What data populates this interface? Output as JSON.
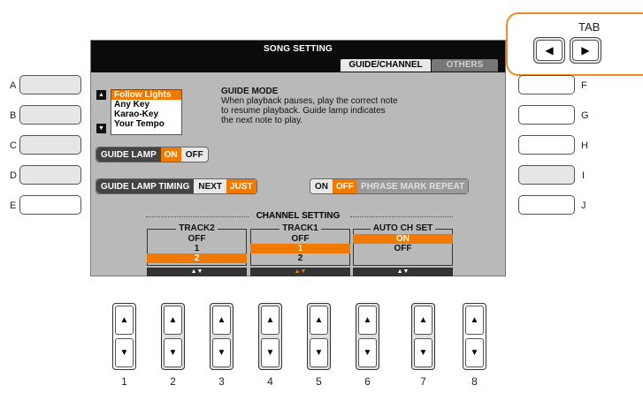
{
  "screen": {
    "title": "SONG SETTING",
    "tabs": [
      {
        "label": "GUIDE/CHANNEL",
        "active": true
      },
      {
        "label": "OTHERS",
        "active": false
      }
    ]
  },
  "tab_control": {
    "title": "TAB",
    "left_glyph": "◀",
    "right_glyph": "▶"
  },
  "left_buttons": [
    "A",
    "B",
    "C",
    "D",
    "E"
  ],
  "right_buttons": [
    "F",
    "G",
    "H",
    "I",
    "J"
  ],
  "guide_mode": {
    "options": [
      "Follow Lights",
      "Any Key",
      "Karao-Key",
      "Your Tempo"
    ],
    "selected": "Follow Lights",
    "heading": "GUIDE MODE",
    "description_lines": [
      "When playback pauses, play the correct note",
      "to resume playback. Guide lamp indicates",
      "the next note to play."
    ],
    "up_glyph": "▲",
    "down_glyph": "▼"
  },
  "guide_lamp": {
    "label": "GUIDE LAMP",
    "on": "ON",
    "off": "OFF",
    "value": "ON"
  },
  "guide_lamp_timing": {
    "label": "GUIDE LAMP TIMING",
    "next": "NEXT",
    "just": "JUST",
    "value": "JUST"
  },
  "phrase_mark_repeat": {
    "on": "ON",
    "off": "OFF",
    "label": "PHRASE MARK REPEAT",
    "value": "OFF"
  },
  "channel_setting": {
    "title": "CHANNEL SETTING",
    "columns": [
      {
        "header": "TRACK2",
        "rows": [
          "OFF",
          "1",
          "2"
        ],
        "selected": "2",
        "foot": "▲▼"
      },
      {
        "header": "TRACK1",
        "rows": [
          "OFF",
          "1",
          "2"
        ],
        "selected": "1",
        "foot": "▲▼"
      },
      {
        "header": "AUTO CH SET",
        "rows": [
          "ON",
          "OFF"
        ],
        "selected": "ON",
        "foot": "▲▼"
      }
    ]
  },
  "bottom_buttons": {
    "numbers": [
      "1",
      "2",
      "3",
      "4",
      "5",
      "6",
      "7",
      "8"
    ],
    "up_glyph": "▲",
    "down_glyph": "▼"
  },
  "colors": {
    "accent": "#f07a00",
    "tab_frame": "#f08a24",
    "screen_bg": "#b9b9b9"
  }
}
